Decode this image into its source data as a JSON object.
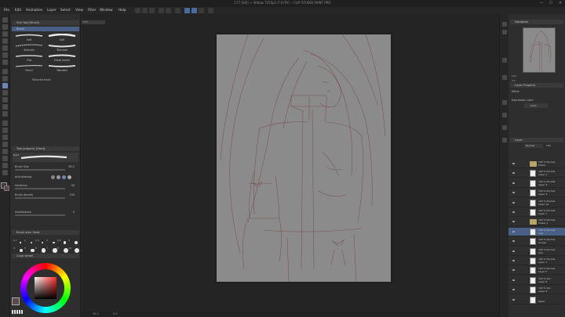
{
  "window": {
    "title": "177 (SAI) + Willow 7255p1-7.0 [Pt] -- CLIP STUDIO PAINT PRO",
    "controls": [
      "—",
      "☐",
      "✕"
    ]
  },
  "menu": {
    "items": [
      "File",
      "Edit",
      "Animation",
      "Layer",
      "Select",
      "View",
      "Filter",
      "Window",
      "Help"
    ]
  },
  "sub_tool_panel": {
    "title": "Sub Tool [Brush]",
    "category": "Brush",
    "brushes": [
      {
        "label": "Soft"
      },
      {
        "label": "Soft"
      },
      {
        "label": "Airbrush"
      },
      {
        "label": "Textured"
      },
      {
        "label": "Flat"
      },
      {
        "label": "Sharp eraser"
      },
      {
        "label": "Pencil"
      },
      {
        "label": "Blended"
      }
    ],
    "extra": "Textured brush"
  },
  "tool_property": {
    "title": "Tool property [Hard]",
    "brush_name": "Hard",
    "rows": [
      {
        "label": "Brush Size",
        "value": "80.0"
      },
      {
        "label": "Anti-aliasing",
        "value": ""
      },
      {
        "label": "Hardness",
        "value": "30"
      },
      {
        "label": "Brush density",
        "value": "100"
      },
      {
        "label": "Stabilization",
        "value": "5"
      }
    ]
  },
  "brush_size_panel": {
    "title": "Brush size: Hard",
    "sizes": [
      "0.7",
      "1",
      "1.5",
      "2",
      "2.5",
      "3",
      "4",
      "5",
      "6",
      "7",
      "8",
      "10"
    ]
  },
  "color_panel": {
    "title": "Color wheel",
    "main_color": "#3b3b3b",
    "sub_color": "#5c4a4a"
  },
  "canvas": {
    "doc_tab": "177",
    "paper_color": "#8b8b8b",
    "sketch_color": "#7a4b4b",
    "status_zoom": "19.1",
    "status_angle": "0.0"
  },
  "navigator": {
    "title": "Navigator",
    "zoom": "19.1",
    "angle": "0.0"
  },
  "layer_property": {
    "title": "Layer Property",
    "effect_label": "Effect",
    "expression_label": "Expression color",
    "expression_value": "Color"
  },
  "layer_panel": {
    "title": "Layer",
    "blend_mode": "Normal",
    "opacity": "100",
    "layers": [
      {
        "type": "folder",
        "line1": "100 % Normal",
        "line2": "Folder"
      },
      {
        "type": "layer",
        "line1": "100 % Normal",
        "line2": "Layer 2"
      },
      {
        "type": "layer",
        "line1": "100 % Normal",
        "line2": "Layer 4"
      },
      {
        "type": "layer",
        "line1": "100 % Normal",
        "line2": "Layer 3"
      },
      {
        "type": "layer",
        "line1": "100 % Normal",
        "line2": "Layer 12"
      },
      {
        "type": "layer",
        "line1": "100 % Normal",
        "line2": "Layer 1"
      },
      {
        "type": "folder",
        "line1": "100 % Normal",
        "line2": "Folder 1"
      },
      {
        "type": "layer",
        "line1": "100 % Normal",
        "line2": "Line",
        "selected": true
      },
      {
        "type": "layer",
        "line1": "100 % Normal",
        "line2": "Screen"
      },
      {
        "type": "layer",
        "line1": "100 % Normal",
        "line2": "Skin"
      },
      {
        "type": "layer",
        "line1": "100 % Normal",
        "line2": "Layer 7"
      },
      {
        "type": "layer",
        "line1": "100 % Normal",
        "line2": "Layer 5"
      },
      {
        "type": "layer",
        "line1": "100 % Nor",
        "line2": "Layer 8"
      },
      {
        "type": "layer",
        "line1": "100 % Nor",
        "line2": "Layer 9"
      },
      {
        "type": "paper",
        "line1": "",
        "line2": "Paper"
      }
    ]
  }
}
